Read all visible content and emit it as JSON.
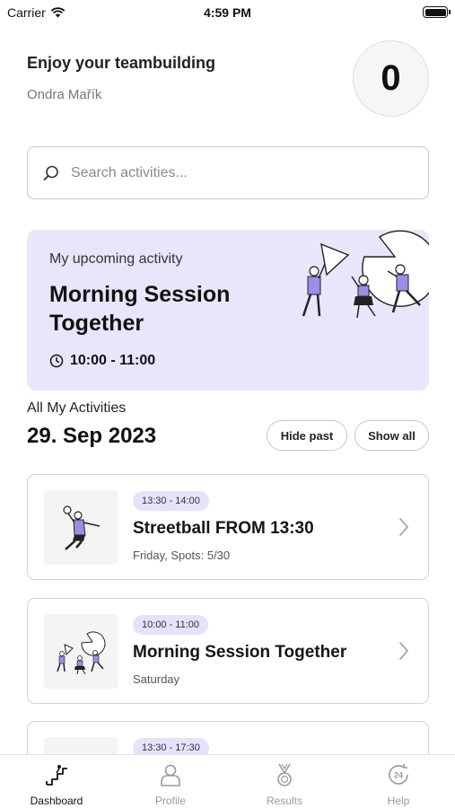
{
  "status_bar": {
    "carrier": "Carrier",
    "time": "4:59 PM"
  },
  "header": {
    "title": "Enjoy your teambuilding",
    "user_name": "Ondra Mařík",
    "score": "0"
  },
  "search": {
    "placeholder": "Search activities..."
  },
  "upcoming": {
    "label": "My upcoming activity",
    "title": "Morning Session Together",
    "time": "10:00 - 11:00",
    "accent_color": "#e9e6fb"
  },
  "activities_section": {
    "label": "All My Activities",
    "date": "29. Sep 2023",
    "hide_past_label": "Hide past",
    "show_all_label": "Show all"
  },
  "activities": [
    {
      "time": "13:30 - 14:00",
      "title": "Streetball FROM 13:30",
      "subtitle": "Friday, Spots: 5/30",
      "icon": "basketball-player-illustration"
    },
    {
      "time": "10:00 - 11:00",
      "title": "Morning Session Together",
      "subtitle": "Saturday",
      "icon": "team-puzzle-illustration"
    },
    {
      "time": "13:30 - 17:30",
      "title": "",
      "subtitle": "",
      "icon": "activity-illustration"
    }
  ],
  "tab_bar": {
    "items": [
      {
        "label": "Dashboard",
        "icon": "stairs-icon",
        "active": true
      },
      {
        "label": "Profile",
        "icon": "user-icon",
        "active": false
      },
      {
        "label": "Results",
        "icon": "medal-icon",
        "active": false
      },
      {
        "label": "Help",
        "icon": "support-24-icon",
        "active": false
      }
    ]
  },
  "colors": {
    "accent_lavender": "#e9e6fb",
    "badge_bg": "#e6e2fb",
    "figure_purple": "#9b8ee6"
  }
}
